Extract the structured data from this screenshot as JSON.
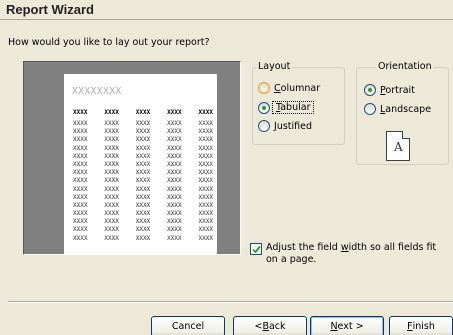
{
  "window": {
    "title": "Report Wizard"
  },
  "question": "How would you like to lay out your report?",
  "preview": {
    "title_placeholder": "XXXXXXXX",
    "column_headers": [
      "XXXX",
      "XXXX",
      "XXXX",
      "XXXX",
      "XXXX"
    ],
    "cell_text": "XXXX"
  },
  "layout": {
    "legend": "Layout",
    "options": [
      {
        "label": "Columnar",
        "mnemonic": "C",
        "rest": "olumnar",
        "selected": false
      },
      {
        "label": "Tabular",
        "mnemonic": "T",
        "rest": "abular",
        "selected": true
      },
      {
        "label": "Justified",
        "mnemonic": "J",
        "rest": "ustified",
        "selected": false
      }
    ]
  },
  "orientation": {
    "legend": "Orientation",
    "options": [
      {
        "label": "Portrait",
        "mnemonic": "P",
        "rest": "ortrait",
        "selected": true
      },
      {
        "label": "Landscape",
        "mnemonic": "L",
        "rest": "andscape",
        "selected": false
      }
    ],
    "page_icon_letter": "A"
  },
  "adjust": {
    "checked": true,
    "text_before": "Adjust the field ",
    "mnemonic": "w",
    "text_after": "idth so all fields fit on a page."
  },
  "buttons": {
    "cancel": "Cancel",
    "back_mnemonic": "B",
    "back_prefix": "< ",
    "back_rest": "ack",
    "next_mnemonic": "N",
    "next_rest": "ext >",
    "finish_mnemonic": "F",
    "finish_rest": "inish"
  },
  "colors": {
    "face": "#ECE9D8",
    "preview_bg": "#808080",
    "radio_dot": "#2D9A2F"
  }
}
